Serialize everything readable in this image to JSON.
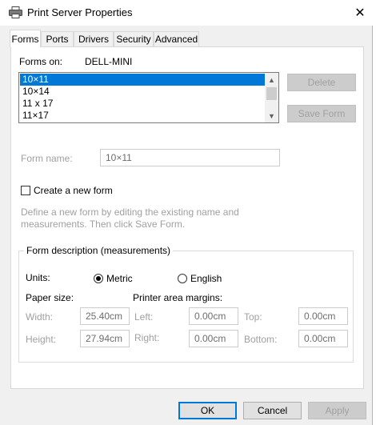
{
  "window": {
    "title": "Print Server Properties"
  },
  "tabs": [
    {
      "label": "Forms"
    },
    {
      "label": "Ports"
    },
    {
      "label": "Drivers"
    },
    {
      "label": "Security"
    },
    {
      "label": "Advanced"
    }
  ],
  "forms_on": {
    "label": "Forms on:",
    "server": "DELL-MINI"
  },
  "form_list": {
    "items": [
      "10×11",
      "10×14",
      "11 x 17",
      "11×17"
    ],
    "selected_index": 0
  },
  "buttons": {
    "delete": "Delete",
    "save_form": "Save Form",
    "ok": "OK",
    "cancel": "Cancel",
    "apply": "Apply"
  },
  "form_name": {
    "label": "Form name:",
    "value": "10×11"
  },
  "create_new": {
    "label": "Create a new form",
    "checked": false
  },
  "hint": "Define a new form by editing the existing name and measurements. Then click Save Form.",
  "description": {
    "group_label": "Form description (measurements)",
    "units_label": "Units:",
    "metric_label": "Metric",
    "english_label": "English",
    "selected_unit": "Metric",
    "paper_size_label": "Paper size:",
    "margins_label": "Printer area margins:",
    "width_label": "Width:",
    "width_value": "25.40cm",
    "height_label": "Height:",
    "height_value": "27.94cm",
    "left_label": "Left:",
    "left_value": "0.00cm",
    "right_label": "Right:",
    "right_value": "0.00cm",
    "top_label": "Top:",
    "top_value": "0.00cm",
    "bottom_label": "Bottom:",
    "bottom_value": "0.00cm"
  }
}
